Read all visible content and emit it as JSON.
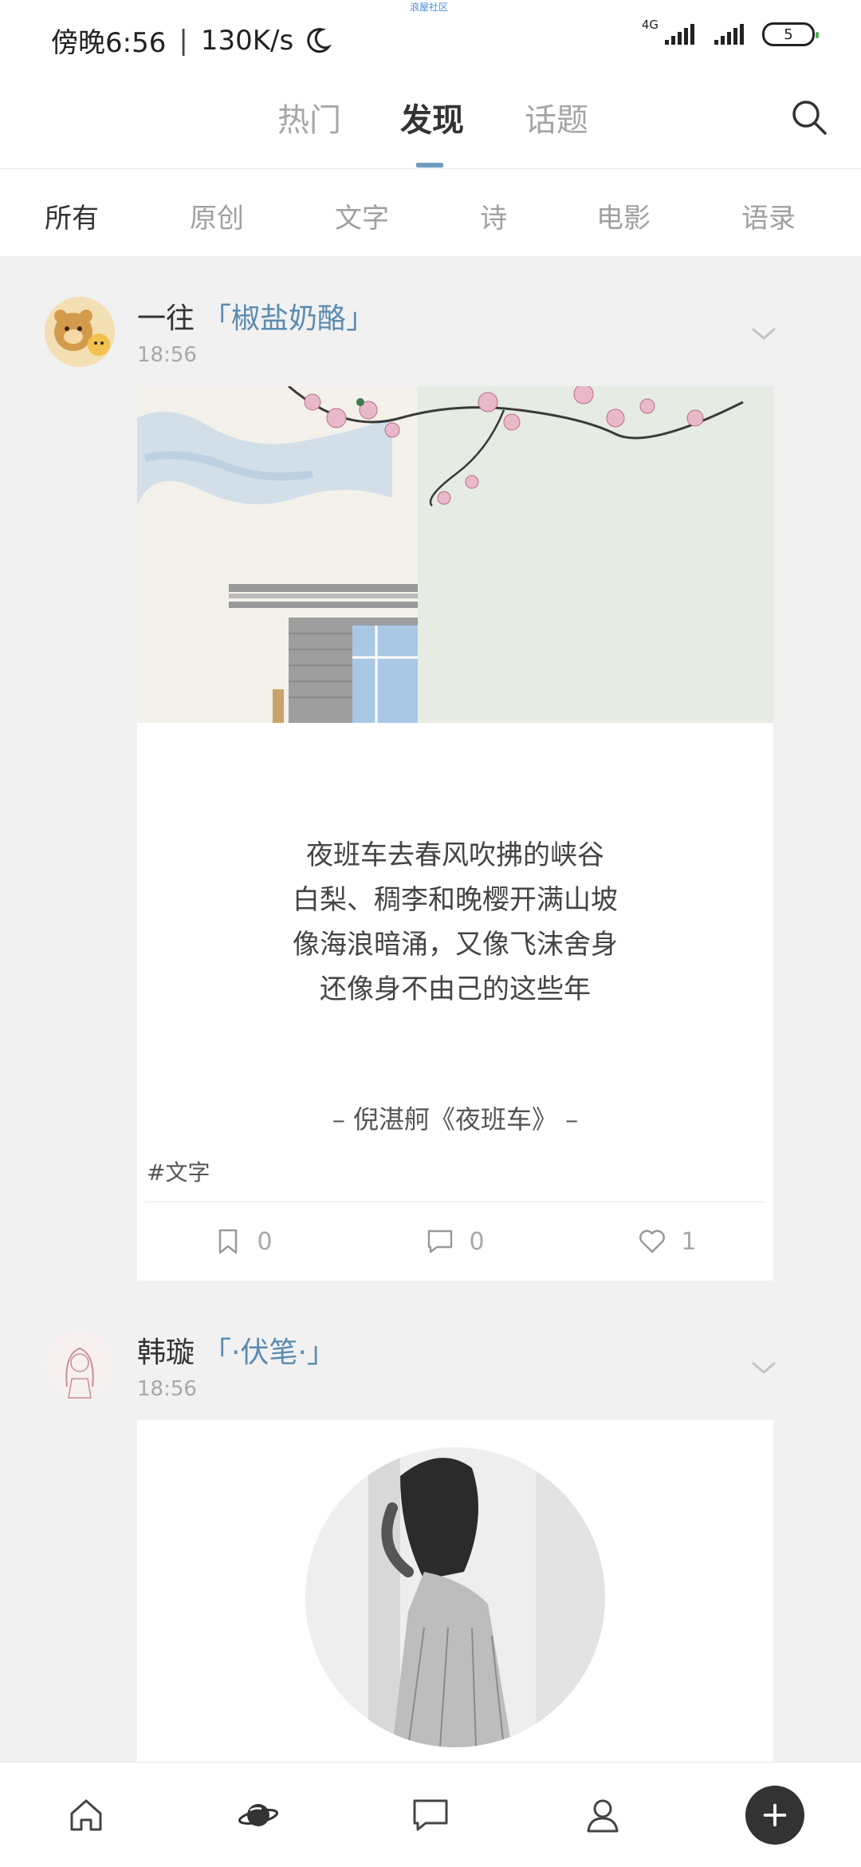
{
  "status": {
    "time": "傍晚6:56",
    "speed": "130K/s",
    "network": "4G",
    "battery": "5",
    "app_tag": "浪屋社区"
  },
  "top_tabs": [
    {
      "label": "热门",
      "active": false
    },
    {
      "label": "发现",
      "active": true
    },
    {
      "label": "话题",
      "active": false
    }
  ],
  "categories": [
    {
      "label": "所有",
      "active": true
    },
    {
      "label": "原创",
      "active": false
    },
    {
      "label": "文字",
      "active": false
    },
    {
      "label": "诗",
      "active": false
    },
    {
      "label": "电影",
      "active": false
    },
    {
      "label": "语录",
      "active": false
    }
  ],
  "posts": [
    {
      "author": "一往",
      "book": "「椒盐奶酪」",
      "time": "18:56",
      "quote_lines": [
        "夜班车去春风吹拂的峡谷",
        "白梨、稠李和晚樱开满山坡",
        "像海浪暗涌，又像飞沫舍身",
        "还像身不由己的这些年"
      ],
      "source": "– 倪湛舸《夜班车》 –",
      "tag": "#文字",
      "bookmarks": "0",
      "comments": "0",
      "likes": "1"
    },
    {
      "author": "韩璇",
      "book": "「·伏笔·」",
      "time": "18:56"
    }
  ],
  "colors": {
    "accent": "#6e9cc0",
    "feed_bg": "#f1f1f1"
  }
}
